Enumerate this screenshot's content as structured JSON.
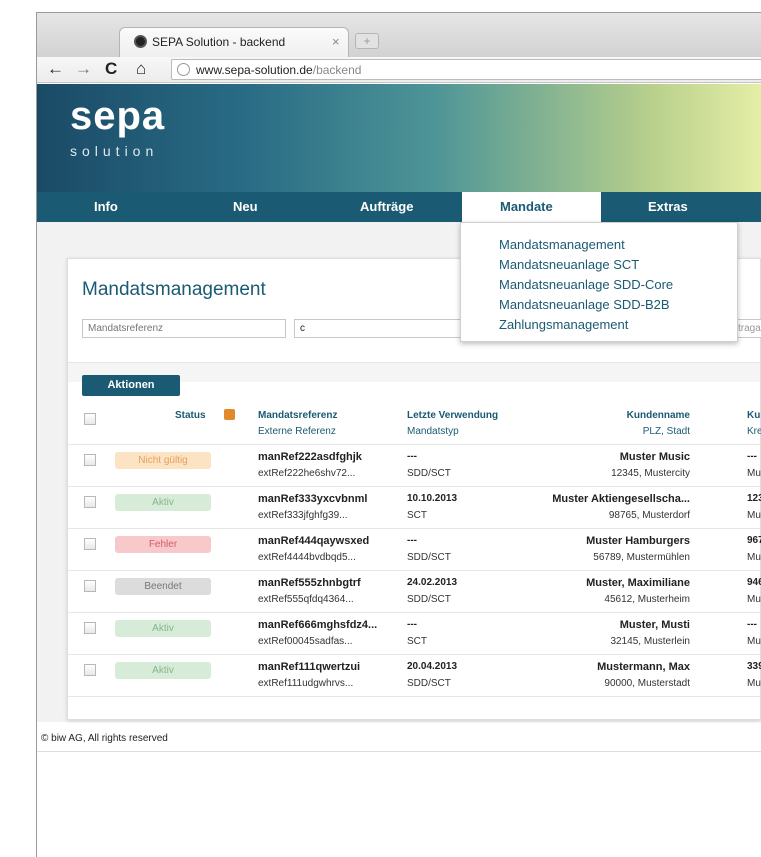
{
  "browser": {
    "tab_title": "SEPA Solution - backend",
    "tab_close": "×",
    "new_tab": "+",
    "url_host": "www.sepa-solution.de",
    "url_path": "/backend",
    "nav_back": "←",
    "nav_forward": "→",
    "nav_reload": "C",
    "nav_home": "⌂"
  },
  "logo": {
    "sepa": "sepa",
    "solution": "solution"
  },
  "nav": {
    "items": [
      "Info",
      "Neu",
      "Aufträge",
      "Mandate",
      "Extras"
    ],
    "active": "Mandate"
  },
  "dropdown": {
    "items": [
      "Mandatsmanagement",
      "Mandatsneuanlage SCT",
      "Mandatsneuanlage SDD-Core",
      "Mandatsneuanlage SDD-B2B",
      "Zahlungsmanagement"
    ]
  },
  "page": {
    "title": "Mandatsmanagement",
    "filter_placeholder": "Mandatsreferenz",
    "filter_value": "c",
    "filter_right": "traga",
    "actions_button": "Aktionen"
  },
  "table": {
    "headers": {
      "status": "Status",
      "ref": "Mandatsreferenz",
      "ref_sub": "Externe Referenz",
      "last_use": "Letzte Verwendung",
      "last_use_sub": "Mandatstyp",
      "customer": "Kundenname",
      "customer_sub": "PLZ, Stadt",
      "col5": "Ku",
      "col5_sub": "Kre"
    },
    "rows": [
      {
        "status": "Nicht gültig",
        "ref": "manRef222asdfghjk",
        "ext": "extRef222he6shv72...",
        "last": "---",
        "type": "SDD/SCT",
        "name": "Muster Music",
        "city": "12345, Mustercity",
        "c5": "---",
        "c5b": "Mu"
      },
      {
        "status": "Aktiv",
        "ref": "manRef333yxcvbnml",
        "ext": "extRef333jfghfg39...",
        "last": "10.10.2013",
        "type": "SCT",
        "name": "Muster Aktiengesellscha...",
        "city": "98765, Musterdorf",
        "c5": "123",
        "c5b": "Mu"
      },
      {
        "status": "Fehler",
        "ref": "manRef444qaywsxed",
        "ext": "extRef4444bvdbqd5...",
        "last": "---",
        "type": "SDD/SCT",
        "name": "Muster Hamburgers",
        "city": "56789, Mustermühlen",
        "c5": "967",
        "c5b": "Mu"
      },
      {
        "status": "Beendet",
        "ref": "manRef555zhnbgtrf",
        "ext": "extRef555qfdq4364...",
        "last": "24.02.2013",
        "type": "SDD/SCT",
        "name": "Muster, Maximiliane",
        "city": "45612, Musterheim",
        "c5": "946",
        "c5b": "Mu"
      },
      {
        "status": "Aktiv",
        "ref": "manRef666mghsfdz4...",
        "ext": "extRef00045sadfas...",
        "last": "---",
        "type": "SCT",
        "name": "Muster, Musti",
        "city": "32145, Musterlein",
        "c5": "---",
        "c5b": "Mu"
      },
      {
        "status": "Aktiv",
        "ref": "manRef111qwertzui",
        "ext": "extRef111udgwhrvs...",
        "last": "20.04.2013",
        "type": "SDD/SCT",
        "name": "Mustermann, Max",
        "city": "90000, Musterstadt",
        "c5": "339",
        "c5b": "Mu"
      }
    ]
  },
  "status_colors": {
    "Nicht gültig": {
      "bg": "#fbe3c4",
      "fg": "#e3a35a"
    },
    "Aktiv": {
      "bg": "#d6ecd8",
      "fg": "#87b28b"
    },
    "Fehler": {
      "bg": "#f8c9cb",
      "fg": "#d55a64"
    },
    "Beendet": {
      "bg": "#dcdcdc",
      "fg": "#777777"
    }
  },
  "footer": {
    "text": "© biw AG, All rights reserved"
  },
  "colors": {
    "brand": "#1b5a73",
    "lock": "#e08a2c"
  }
}
